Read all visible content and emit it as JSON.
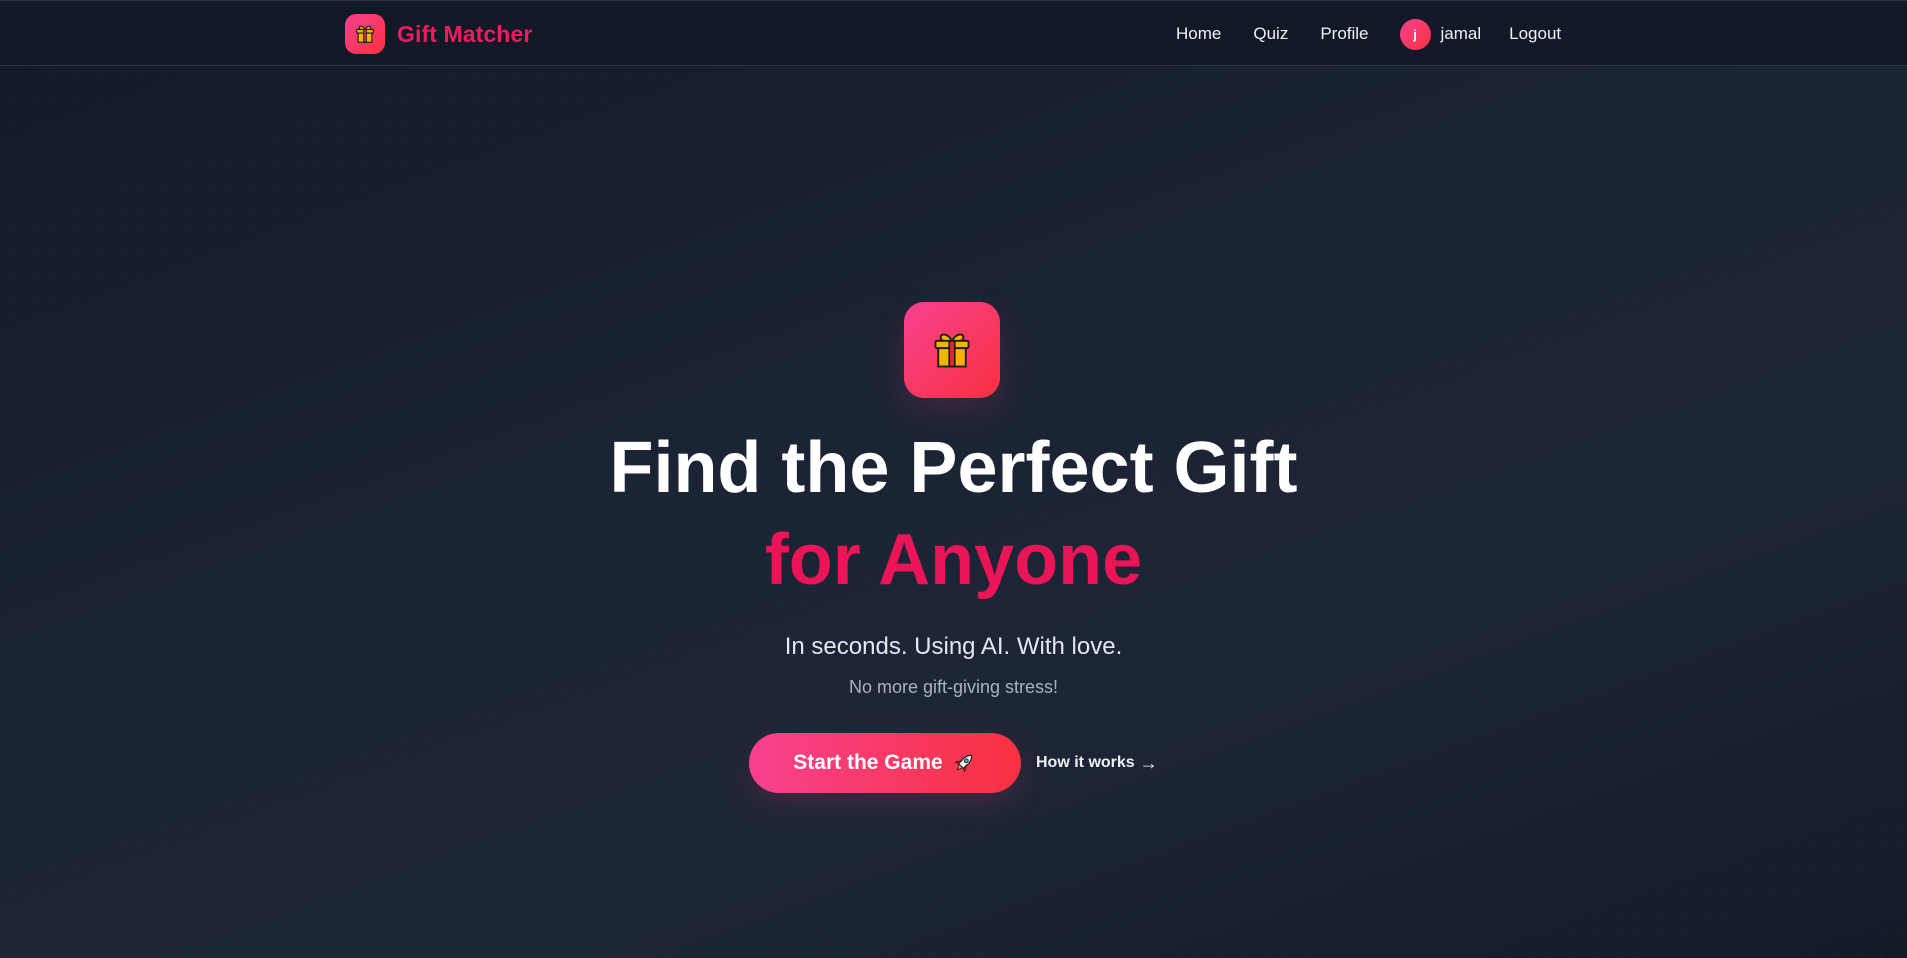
{
  "header": {
    "brand_name": "Gift Matcher",
    "brand_icon": "gift-icon",
    "nav": {
      "home": "Home",
      "quiz": "Quiz",
      "profile": "Profile"
    },
    "user": {
      "avatar_initial": "j",
      "name": "jamal"
    },
    "logout": "Logout"
  },
  "hero": {
    "icon": "gift-icon",
    "title_line1": "Find the Perfect Gift",
    "title_line2": "for Anyone",
    "tagline": "In seconds. Using AI. With love.",
    "subtagline": "No more gift-giving stress!",
    "cta_label": "Start the Game",
    "cta_icon": "rocket-icon",
    "secondary_label": "How it works",
    "secondary_arrow": "→"
  },
  "colors": {
    "accent": "#ec1d5f",
    "gradient_start": "#f7418f",
    "gradient_end": "#f8313f",
    "background": "#1b2435",
    "header_bg": "#121826"
  }
}
